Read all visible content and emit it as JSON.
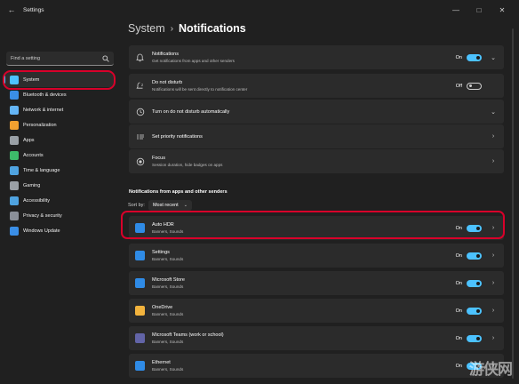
{
  "titlebar": {
    "app_title": "Settings",
    "back_icon": "back-arrow-icon",
    "controls": [
      "minimize-icon",
      "maximize-icon",
      "close-icon"
    ]
  },
  "sidebar": {
    "search_placeholder": "Find a setting",
    "items": [
      {
        "label": "System",
        "icon": "system-icon",
        "color": "#4cc2ff",
        "active": true
      },
      {
        "label": "Bluetooth & devices",
        "icon": "bluetooth-icon",
        "color": "#3a8ee6"
      },
      {
        "label": "Network & internet",
        "icon": "wifi-icon",
        "color": "#64b5f6"
      },
      {
        "label": "Personalization",
        "icon": "brush-icon",
        "color": "#f0a030"
      },
      {
        "label": "Apps",
        "icon": "apps-icon",
        "color": "#9aa0a6"
      },
      {
        "label": "Accounts",
        "icon": "person-icon",
        "color": "#3dbb6a"
      },
      {
        "label": "Time & language",
        "icon": "globe-clock-icon",
        "color": "#4fa3e0"
      },
      {
        "label": "Gaming",
        "icon": "gamepad-icon",
        "color": "#9aa0a6"
      },
      {
        "label": "Accessibility",
        "icon": "accessibility-icon",
        "color": "#4fa3e0"
      },
      {
        "label": "Privacy & security",
        "icon": "shield-icon",
        "color": "#8a8f98"
      },
      {
        "label": "Windows Update",
        "icon": "update-icon",
        "color": "#3a8ee6"
      }
    ]
  },
  "main": {
    "breadcrumb": {
      "parent": "System",
      "separator": "›",
      "current": "Notifications"
    },
    "settings": [
      {
        "title": "Notifications",
        "subtitle": "Get notifications from apps and other senders",
        "icon": "bell-icon",
        "state": "On",
        "toggle": "on",
        "chevron": "down"
      },
      {
        "title": "Do not disturb",
        "subtitle": "Notifications will be sent directly to notification center",
        "icon": "do-not-disturb-icon",
        "state": "Off",
        "toggle": "off",
        "chevron": ""
      },
      {
        "title": "Turn on do not disturb automatically",
        "subtitle": "",
        "icon": "clock-icon",
        "state": "",
        "toggle": "",
        "chevron": "down"
      },
      {
        "title": "Set priority notifications",
        "subtitle": "",
        "icon": "priority-icon",
        "state": "",
        "toggle": "",
        "chevron": "right"
      },
      {
        "title": "Focus",
        "subtitle": "Session duration, hide badges on apps",
        "icon": "focus-icon",
        "state": "",
        "toggle": "",
        "chevron": "right"
      }
    ],
    "section_heading": "Notifications from apps and other senders",
    "sort": {
      "label": "Sort by:",
      "value": "Most recent"
    },
    "apps": [
      {
        "title": "Auto HDR",
        "subtitle": "Banners, Sounds",
        "icon": "auto-hdr-icon",
        "color": "#2f8be6",
        "state": "On"
      },
      {
        "title": "Settings",
        "subtitle": "Banners, Sounds",
        "icon": "settings-app-icon",
        "color": "#2f8be6",
        "state": "On"
      },
      {
        "title": "Microsoft Store",
        "subtitle": "Banners, Sounds",
        "icon": "store-icon",
        "color": "#2f8be6",
        "state": "On"
      },
      {
        "title": "OneDrive",
        "subtitle": "Banners, Sounds",
        "icon": "onedrive-icon",
        "color": "#f2b33d",
        "state": "On"
      },
      {
        "title": "Microsoft Teams (work or school)",
        "subtitle": "Banners, Sounds",
        "icon": "teams-icon",
        "color": "#6264a7",
        "state": "On"
      },
      {
        "title": "Ethernet",
        "subtitle": "Banners, Sounds",
        "icon": "ethernet-icon",
        "color": "#2f8be6",
        "state": "On"
      }
    ]
  },
  "watermark": "游侠网"
}
